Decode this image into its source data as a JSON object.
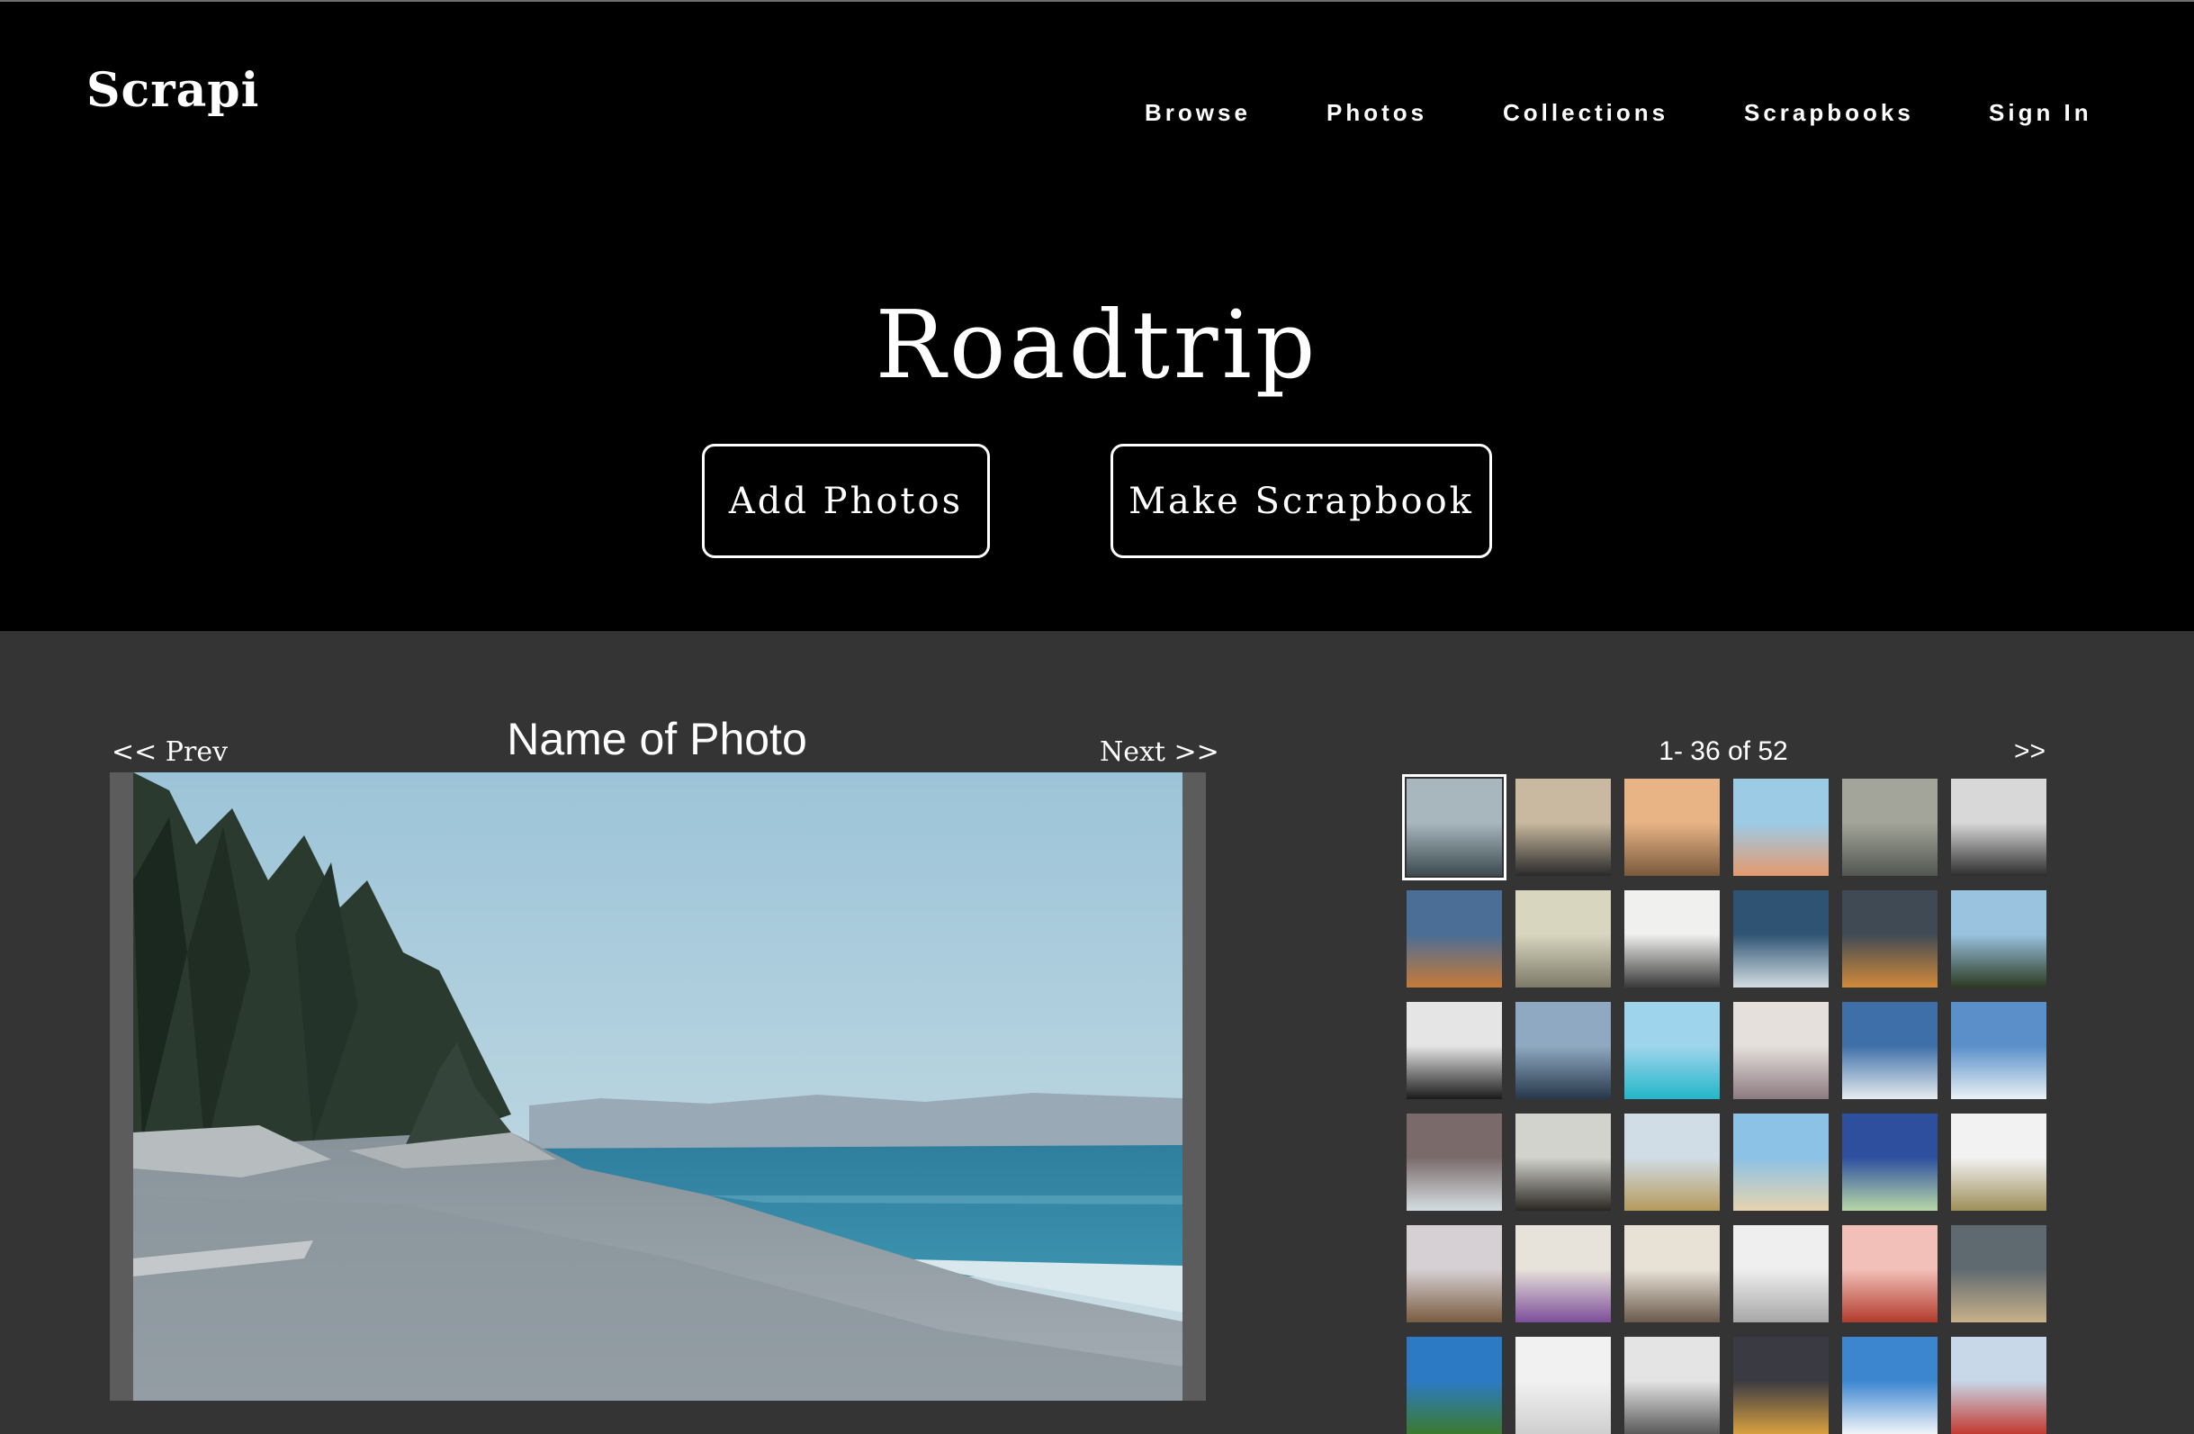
{
  "brand": {
    "name": "Scrapi"
  },
  "nav": {
    "items": [
      {
        "label": "Browse"
      },
      {
        "label": "Photos"
      },
      {
        "label": "Collections"
      },
      {
        "label": "Scrapbooks"
      },
      {
        "label": "Sign In"
      }
    ]
  },
  "album": {
    "title": "Roadtrip"
  },
  "actions": {
    "add_photos": "Add Photos",
    "make_scrapbook": "Make Scrapbook"
  },
  "viewer": {
    "prev": "<< Prev",
    "next": "Next >>",
    "photo_name": "Name of Photo"
  },
  "gallery": {
    "counter": "1- 36 of 52",
    "next_page": ">>",
    "selected_index": 0,
    "thumbnails": [
      {
        "colors": [
          "#a8b7bd",
          "#3c4b50"
        ]
      },
      {
        "colors": [
          "#c9b9a0",
          "#2a2a2a"
        ]
      },
      {
        "colors": [
          "#e8b486",
          "#7a5a3c"
        ]
      },
      {
        "colors": [
          "#9ccbe6",
          "#e49a6e"
        ]
      },
      {
        "colors": [
          "#a3a59a",
          "#525751"
        ]
      },
      {
        "colors": [
          "#d8d8d8",
          "#2e2e2e"
        ]
      },
      {
        "colors": [
          "#4a6e96",
          "#c77a38"
        ]
      },
      {
        "colors": [
          "#d9d6c0",
          "#7d7a68"
        ]
      },
      {
        "colors": [
          "#f0f0ee",
          "#3a3a3a"
        ]
      },
      {
        "colors": [
          "#2f5473",
          "#d2dde2"
        ]
      },
      {
        "colors": [
          "#3f4a55",
          "#d38a3a"
        ]
      },
      {
        "colors": [
          "#9ac3e0",
          "#2c3a22"
        ]
      },
      {
        "colors": [
          "#e5e5e5",
          "#1a1a1a"
        ]
      },
      {
        "colors": [
          "#8fa9c2",
          "#27384a"
        ]
      },
      {
        "colors": [
          "#9fd5ec",
          "#23b6c9"
        ]
      },
      {
        "colors": [
          "#e6e0dc",
          "#8c7a80"
        ]
      },
      {
        "colors": [
          "#3f6fa8",
          "#e6ecef"
        ]
      },
      {
        "colors": [
          "#5a8fca",
          "#e9f1f4"
        ]
      },
      {
        "colors": [
          "#7a6a6a",
          "#d5dee2"
        ]
      },
      {
        "colors": [
          "#d2d3cc",
          "#2a2622"
        ]
      },
      {
        "colors": [
          "#d0dde6",
          "#b69a5c"
        ]
      },
      {
        "colors": [
          "#8cc2e6",
          "#e6d3ad"
        ]
      },
      {
        "colors": [
          "#2d4f9e",
          "#b8d8a8"
        ]
      },
      {
        "colors": [
          "#f2f2f2",
          "#9e8f58"
        ]
      },
      {
        "colors": [
          "#d6d0d4",
          "#7a5c40"
        ]
      },
      {
        "colors": [
          "#e7e2da",
          "#7d4e9a"
        ]
      },
      {
        "colors": [
          "#e8e2d6",
          "#6a5a4c"
        ]
      },
      {
        "colors": [
          "#efefef",
          "#a7a7a7"
        ]
      },
      {
        "colors": [
          "#f2c0b8",
          "#b33b2c"
        ]
      },
      {
        "colors": [
          "#5f6a70",
          "#c9b089"
        ]
      },
      {
        "colors": [
          "#2c7ac4",
          "#3b7a2f"
        ]
      },
      {
        "colors": [
          "#f1f1f1",
          "#cfcfcf"
        ]
      },
      {
        "colors": [
          "#e4e4e4",
          "#5a5a5a"
        ]
      },
      {
        "colors": [
          "#3a3a42",
          "#d8a040"
        ]
      },
      {
        "colors": [
          "#3c86d0",
          "#f0f4f8"
        ]
      },
      {
        "colors": [
          "#c8d8e8",
          "#c23a30"
        ]
      }
    ]
  }
}
